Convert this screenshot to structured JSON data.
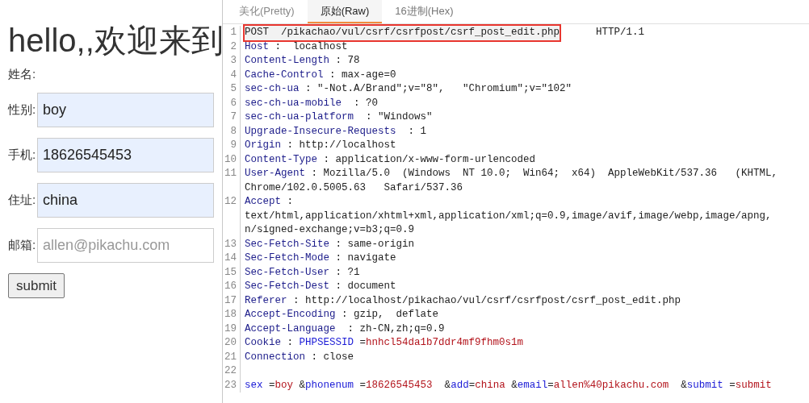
{
  "page": {
    "heading": "hello,,欢迎来到",
    "fields": [
      {
        "label": "姓名:",
        "kind": "text-only"
      },
      {
        "label": "性别:",
        "kind": "input",
        "value": "boy",
        "autofilled": true
      },
      {
        "label": "手机:",
        "kind": "input",
        "value": "18626545453",
        "autofilled": true
      },
      {
        "label": "住址:",
        "kind": "input",
        "value": "china",
        "autofilled": true
      },
      {
        "label": "邮箱:",
        "kind": "input",
        "placeholder": "allen@pikachu.com",
        "autofilled": false
      }
    ],
    "submit": "submit"
  },
  "editor": {
    "tabs": [
      {
        "label": "美化(Pretty)",
        "selected": false
      },
      {
        "label": "原始(Raw)",
        "selected": true
      },
      {
        "label": "16进制(Hex)",
        "selected": false
      }
    ],
    "lines": [
      {
        "number": "1",
        "segments": [
          {
            "kind": "plain",
            "text": "POST  /pikachao/vul/csrf/csrfpost/csrf_post_edit.php",
            "boxed": true
          },
          {
            "kind": "plain",
            "text": "      HTTP/1.1",
            "boxed": false
          }
        ]
      },
      {
        "number": "2",
        "segments": [
          {
            "kind": "key",
            "text": "Host"
          },
          {
            "kind": "plain",
            "text": " :  localhost"
          }
        ]
      },
      {
        "number": "3",
        "segments": [
          {
            "kind": "key",
            "text": "Content-Length"
          },
          {
            "kind": "plain",
            "text": " : 78"
          }
        ]
      },
      {
        "number": "4",
        "segments": [
          {
            "kind": "key",
            "text": "Cache-Control"
          },
          {
            "kind": "plain",
            "text": " : max-age=0"
          }
        ]
      },
      {
        "number": "5",
        "segments": [
          {
            "kind": "key",
            "text": "sec-ch-ua"
          },
          {
            "kind": "plain",
            "text": " : \"-Not.A/Brand\";v=\"8\",   \"Chromium\";v=\"102\""
          }
        ]
      },
      {
        "number": "6",
        "segments": [
          {
            "kind": "key",
            "text": "sec-ch-ua-mobile"
          },
          {
            "kind": "plain",
            "text": "  : ?0"
          }
        ]
      },
      {
        "number": "7",
        "segments": [
          {
            "kind": "key",
            "text": "sec-ch-ua-platform"
          },
          {
            "kind": "plain",
            "text": "  : \"Windows\""
          }
        ]
      },
      {
        "number": "8",
        "segments": [
          {
            "kind": "key",
            "text": "Upgrade-Insecure-Requests"
          },
          {
            "kind": "plain",
            "text": "  : 1"
          }
        ]
      },
      {
        "number": "9",
        "segments": [
          {
            "kind": "key",
            "text": "Origin"
          },
          {
            "kind": "plain",
            "text": " : http://localhost"
          }
        ]
      },
      {
        "number": "10",
        "segments": [
          {
            "kind": "key",
            "text": "Content-Type"
          },
          {
            "kind": "plain",
            "text": " : application/x-www-form-urlencoded"
          }
        ]
      },
      {
        "number": "11",
        "segments": [
          {
            "kind": "key",
            "text": "User-Agent"
          },
          {
            "kind": "plain",
            "text": " : Mozilla/5.0  (Windows  NT 10.0;  Win64;  x64)  AppleWebKit/537.36   (KHTML,"
          }
        ],
        "continued": [
          "Chrome/102.0.5005.63   Safari/537.36"
        ]
      },
      {
        "number": "12",
        "segments": [
          {
            "kind": "key",
            "text": "Accept"
          },
          {
            "kind": "plain",
            "text": " :"
          }
        ],
        "continued": [
          "text/html,application/xhtml+xml,application/xml;q=0.9,image/avif,image/webp,image/apng,",
          "n/signed-exchange;v=b3;q=0.9"
        ]
      },
      {
        "number": "13",
        "segments": [
          {
            "kind": "key",
            "text": "Sec-Fetch-Site"
          },
          {
            "kind": "plain",
            "text": " : same-origin"
          }
        ]
      },
      {
        "number": "14",
        "segments": [
          {
            "kind": "key",
            "text": "Sec-Fetch-Mode"
          },
          {
            "kind": "plain",
            "text": " : navigate"
          }
        ]
      },
      {
        "number": "15",
        "segments": [
          {
            "kind": "key",
            "text": "Sec-Fetch-User"
          },
          {
            "kind": "plain",
            "text": " : ?1"
          }
        ]
      },
      {
        "number": "16",
        "segments": [
          {
            "kind": "key",
            "text": "Sec-Fetch-Dest"
          },
          {
            "kind": "plain",
            "text": " : document"
          }
        ]
      },
      {
        "number": "17",
        "segments": [
          {
            "kind": "key",
            "text": "Referer"
          },
          {
            "kind": "plain",
            "text": " : http://localhost/pikachao/vul/csrf/csrfpost/csrf_post_edit.php"
          }
        ]
      },
      {
        "number": "18",
        "segments": [
          {
            "kind": "key",
            "text": "Accept-Encoding"
          },
          {
            "kind": "plain",
            "text": " : gzip,  deflate"
          }
        ]
      },
      {
        "number": "19",
        "segments": [
          {
            "kind": "key",
            "text": "Accept-Language"
          },
          {
            "kind": "plain",
            "text": "  : zh-CN,zh;q=0.9"
          }
        ]
      },
      {
        "number": "20",
        "segments": [
          {
            "kind": "key",
            "text": "Cookie"
          },
          {
            "kind": "plain",
            "text": " : "
          },
          {
            "kind": "name",
            "text": "PHPSESSID"
          },
          {
            "kind": "plain",
            "text": " ="
          },
          {
            "kind": "value",
            "text": "hnhcl54da1b7ddr4mf9fhm0s1m"
          }
        ]
      },
      {
        "number": "21",
        "segments": [
          {
            "kind": "key",
            "text": "Connection"
          },
          {
            "kind": "plain",
            "text": " : close"
          }
        ]
      },
      {
        "number": "22"
      },
      {
        "number": "23",
        "segments": [
          {
            "kind": "name",
            "text": "sex"
          },
          {
            "kind": "plain",
            "text": " ="
          },
          {
            "kind": "value",
            "text": "boy"
          },
          {
            "kind": "plain",
            "text": " &"
          },
          {
            "kind": "name",
            "text": "phonenum"
          },
          {
            "kind": "plain",
            "text": " ="
          },
          {
            "kind": "value",
            "text": "18626545453"
          },
          {
            "kind": "plain",
            "text": "  &"
          },
          {
            "kind": "name",
            "text": "add"
          },
          {
            "kind": "plain",
            "text": "="
          },
          {
            "kind": "value",
            "text": "china"
          },
          {
            "kind": "plain",
            "text": " &"
          },
          {
            "kind": "name",
            "text": "email"
          },
          {
            "kind": "plain",
            "text": "="
          },
          {
            "kind": "value",
            "text": "allen%40pikachu.com"
          },
          {
            "kind": "plain",
            "text": "  &"
          },
          {
            "kind": "name",
            "text": "submit"
          },
          {
            "kind": "plain",
            "text": " ="
          },
          {
            "kind": "value",
            "text": "submit"
          }
        ]
      }
    ]
  }
}
